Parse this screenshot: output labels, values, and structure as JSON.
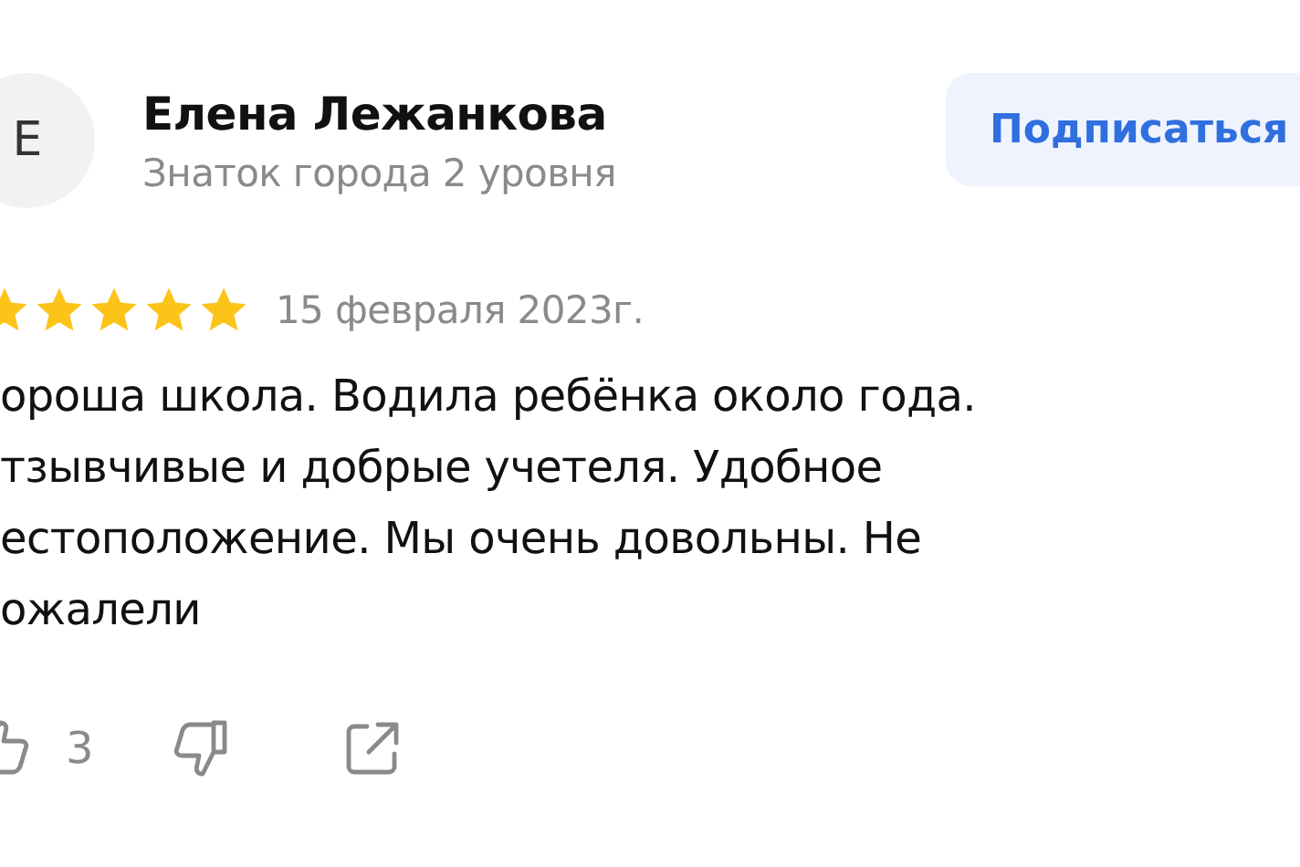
{
  "author": {
    "initial": "Е",
    "name": "Елена Лежанкова",
    "status": "Знаток города 2 уровня"
  },
  "subscribe_button": "Подписаться",
  "review": {
    "stars": 5,
    "date": "15 февраля 2023г.",
    "lines": [
      "ороша школа. Водила ребёнка около года.",
      "тзывчивые и добрые учетеля. Удобное",
      "естоположение. Мы очень довольны. Не",
      "ожалели"
    ]
  },
  "actions": {
    "likes": "3"
  }
}
